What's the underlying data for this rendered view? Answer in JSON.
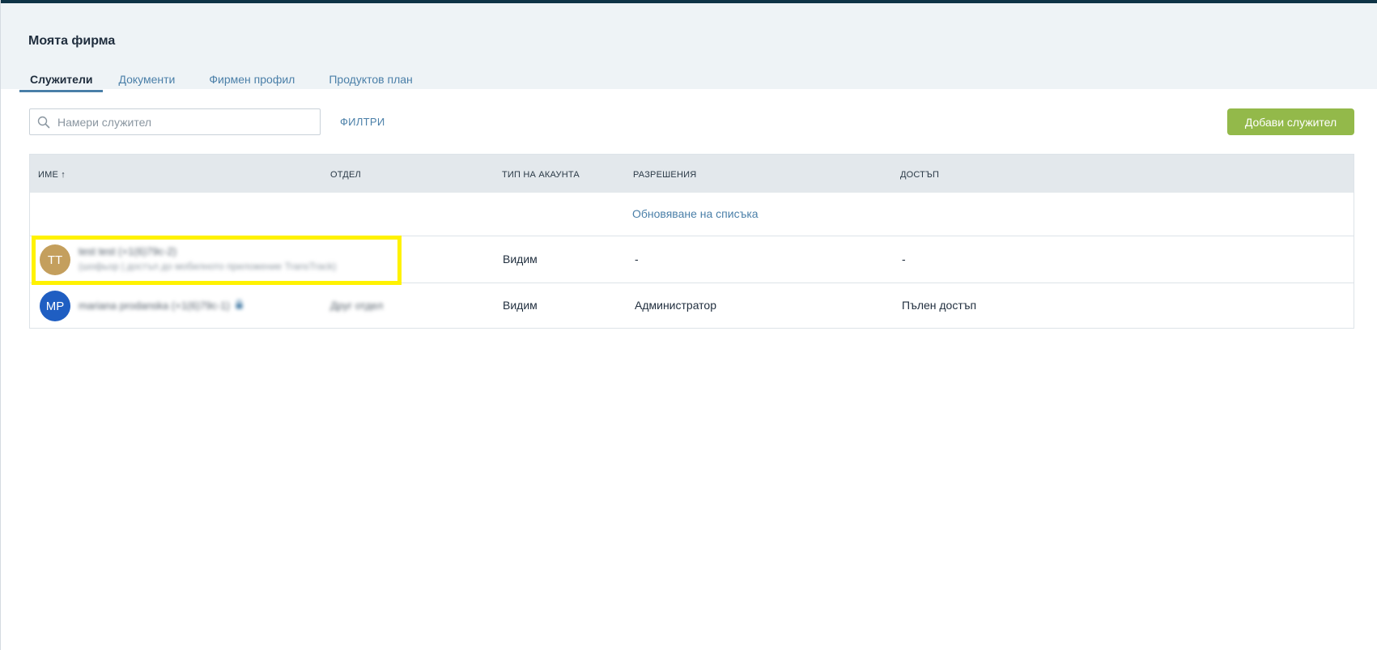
{
  "page": {
    "title": "Моята фирма"
  },
  "tabs": [
    {
      "label": "Служители",
      "active": true
    },
    {
      "label": "Документи",
      "active": false
    },
    {
      "label": "Фирмен профил",
      "active": false
    },
    {
      "label": "Продуктов план",
      "active": false
    }
  ],
  "toolbar": {
    "search_placeholder": "Намери служител",
    "search_value": "",
    "filters_label": "ФИЛТРИ",
    "add_label": "Добави служител"
  },
  "table": {
    "columns": {
      "name": "ИМЕ",
      "name_sort_indicator": "↑",
      "department": "ОТДЕЛ",
      "account_type": "ТИП НА АКАУНТА",
      "permissions": "РАЗРЕШЕНИЯ",
      "access": "ДОСТЪП"
    },
    "refresh_label": "Обновяване на списъка",
    "rows": [
      {
        "initials": "TT",
        "name": "test test (+1(6)79c-2)",
        "subtitle": "(шофьор | достъп до мобилното приложение TransTrack)",
        "department": "",
        "account_type": "Видим",
        "permissions": "-",
        "access": "-"
      },
      {
        "initials": "MP",
        "name": "mariana prodanska (+1(6)79c-1)",
        "subtitle": "",
        "department": "Друг отдел",
        "account_type": "Видим",
        "permissions": "Администратор",
        "access": "Пълен достъп"
      }
    ]
  },
  "colors": {
    "topbar": "#0e3346",
    "header_bg": "#eef3f6",
    "link": "#4a7fa8",
    "add_button": "#93b94a",
    "avatar_tt": "#c49f5d",
    "avatar_mp": "#1f5ec2",
    "highlight": "#fff200"
  },
  "icons": {
    "search": "search-icon",
    "lock": "lock-icon"
  }
}
